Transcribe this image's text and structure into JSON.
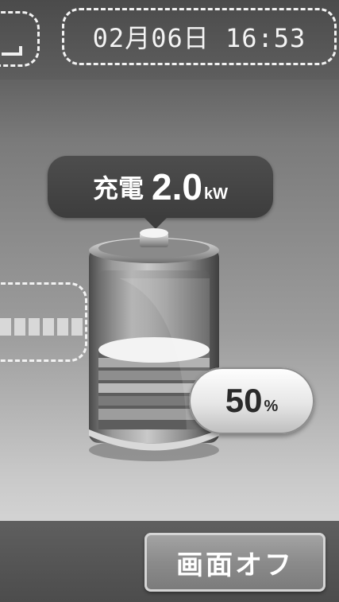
{
  "header": {
    "datetime": "02月06日 16:53"
  },
  "charge_status": {
    "label": "充電",
    "value": "2.0",
    "unit": "kW"
  },
  "battery": {
    "percent_value": "50",
    "percent_sign": "%",
    "level": 0.5
  },
  "footer": {
    "screen_off_label": "画面オフ"
  },
  "colors": {
    "background_top": "#545454",
    "background_bottom": "#d2d2d2",
    "bubble": "#444444",
    "button": "#8b8b8b"
  },
  "icons": {
    "battery": "battery-icon",
    "left_indicator": "signal-indicator-icon"
  }
}
